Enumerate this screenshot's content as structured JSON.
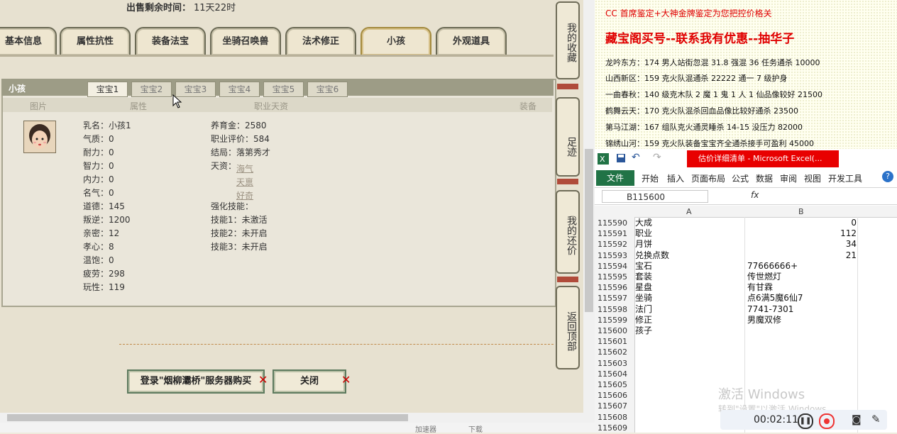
{
  "game": {
    "sale_label": "出售剩余时间：",
    "sale_time": "11天22时",
    "tabs": [
      {
        "label": "基本信息"
      },
      {
        "label": "属性抗性"
      },
      {
        "label": "装备法宝"
      },
      {
        "label": "坐骑召唤兽"
      },
      {
        "label": "法术修正"
      },
      {
        "label": "小孩"
      },
      {
        "label": "外观道具"
      }
    ],
    "active_tab": "小孩",
    "panel_title": "小孩",
    "subtabs": [
      "宝宝1",
      "宝宝2",
      "宝宝3",
      "宝宝4",
      "宝宝5",
      "宝宝6"
    ],
    "columns": [
      "图片",
      "属性",
      "职业天资",
      "装备"
    ],
    "attrs": [
      "乳名：小孩1",
      "气质：0",
      "耐力：0",
      "智力：0",
      "内力：0",
      "名气：0",
      "道德：145",
      "叛逆：1200",
      "亲密：12",
      "孝心：8",
      "温饱：0",
      "疲劳：298",
      "玩性：119"
    ],
    "career": {
      "raise": "养育金：2580",
      "rating": "职业评价：584",
      "ending": "结局：落第秀才",
      "talent_label": "天资：",
      "talents": [
        "海气",
        "天禀",
        "好奇"
      ],
      "skill_label": "强化技能：",
      "skills": [
        "技能1：未激活",
        "技能2：未开启",
        "技能3：未开启"
      ]
    },
    "buttons": {
      "login": "登录\"烟柳灞桥\"服务器购买",
      "close": "关闭"
    },
    "side_buttons": [
      "我的收藏",
      "足迹",
      "我的还价",
      "返回顶部"
    ],
    "status": {
      "speed": "加速器",
      "download": "下载"
    }
  },
  "doc": {
    "line_red": "CC 首席鉴定+大神金牌鉴定为您把控价格关",
    "title": "藏宝阁买号--联系我有优惠--抽华子",
    "lines": [
      "龙吟东方：174 男人站街忽混 31.8 强混 36 任务通杀 10000",
      "山西新区：159 克火队混通杀 22222 通一 7 级护身",
      "一曲春秋：140 级克木队 2 魔 1 鬼 1 人 1 仙品像较好 21500",
      "鹤舞云天：170 克火队混杀回血品像比较好通杀 23500",
      "第马江湖：167 组队克火通灵睡杀 14-15 没压力 82000",
      "锦绣山河：159 克火队装备宝宝齐全通杀接手可盈利 45000"
    ]
  },
  "excel": {
    "doc_title": "估价详细清单 - Microsoft Excel(...",
    "file_tab": "文件",
    "menus": [
      "开始",
      "插入",
      "页面布局",
      "公式",
      "数据",
      "审阅",
      "视图",
      "开发工具"
    ],
    "name_box": "B115600",
    "fx": "fx",
    "col_a": "A",
    "col_b": "B",
    "rows": [
      {
        "n": "115590",
        "a": "大成",
        "b": "0",
        "num": true
      },
      {
        "n": "115591",
        "a": "职业",
        "b": "112",
        "num": true
      },
      {
        "n": "115592",
        "a": "月饼",
        "b": "34",
        "num": true
      },
      {
        "n": "115593",
        "a": "兑换点数",
        "b": "21",
        "num": true
      },
      {
        "n": "115594",
        "a": "宝石",
        "b": "77666666+",
        "num": false
      },
      {
        "n": "115595",
        "a": "套装",
        "b": "传世燃灯",
        "num": false
      },
      {
        "n": "115596",
        "a": "星盘",
        "b": "有甘霖",
        "num": false
      },
      {
        "n": "115597",
        "a": "坐骑",
        "b": "点6满5魔6仙7",
        "num": false
      },
      {
        "n": "115598",
        "a": "法门",
        "b": "7741-7301",
        "num": false
      },
      {
        "n": "115599",
        "a": "修正",
        "b": "男魔双修",
        "num": false
      },
      {
        "n": "115600",
        "a": "孩子",
        "b": "",
        "num": false
      },
      {
        "n": "115601",
        "a": "",
        "b": "",
        "num": false
      },
      {
        "n": "115602",
        "a": "",
        "b": "",
        "num": false
      },
      {
        "n": "115603",
        "a": "",
        "b": "",
        "num": false
      },
      {
        "n": "115604",
        "a": "",
        "b": "",
        "num": false
      },
      {
        "n": "115605",
        "a": "",
        "b": "",
        "num": false
      },
      {
        "n": "115606",
        "a": "",
        "b": "",
        "num": false
      },
      {
        "n": "115607",
        "a": "",
        "b": "",
        "num": false
      },
      {
        "n": "115608",
        "a": "",
        "b": "",
        "num": false
      },
      {
        "n": "115609",
        "a": "",
        "b": "",
        "num": false
      }
    ],
    "watermark": "激活 Windows",
    "watermark_sub": "转到\"设置\"以激活 Windows。",
    "timer": "00:02:11"
  }
}
